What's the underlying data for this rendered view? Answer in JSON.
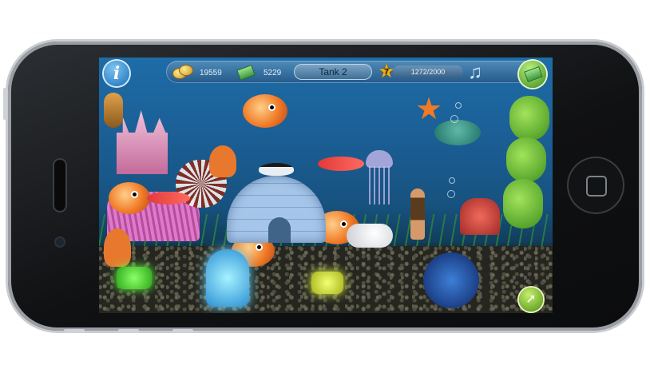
{
  "hud": {
    "coins": "19559",
    "cash": "5229",
    "tank_name": "Tank 2",
    "level": "7",
    "xp": "1272/2000"
  },
  "buttons": {
    "info_glyph": "i",
    "music_glyph": "♫",
    "cursor_glyph": "➚"
  },
  "icons": {
    "info": "info-icon",
    "coins": "gold-coins-icon",
    "cash": "cash-icon",
    "level": "star-icon",
    "music": "music-note-icon",
    "shop": "shop-icon",
    "cursor": "cursor-arrow-icon"
  },
  "colors": {
    "water_top": "#1e6ca8",
    "water_bottom": "#123e5c",
    "gravel": "#25261f",
    "accent_green": "#4f8f12",
    "star_gold": "#f5b316"
  }
}
